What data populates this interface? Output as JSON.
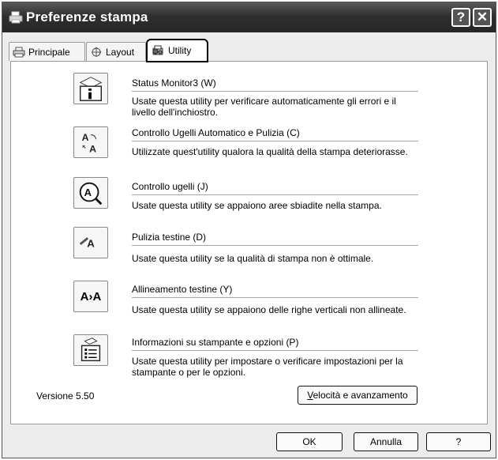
{
  "window": {
    "title": "Preferenze stampa",
    "help_glyph": "?",
    "close_glyph": "✕"
  },
  "tabs": [
    {
      "label": "Principale",
      "icon": "printer-icon"
    },
    {
      "label": "Layout",
      "icon": "layout-icon"
    },
    {
      "label": "Utility",
      "icon": "tools-icon",
      "selected": true
    }
  ],
  "utilities": [
    {
      "title": "Status Monitor3 (W)",
      "description": "Usate questa utility per verificare automaticamente gli errori e il livello dell'inchiostro.",
      "icon": "status-monitor-icon"
    },
    {
      "title": "Controllo Ugelli Automatico e Pulizia (C)",
      "description": "Utilizzate quest'utility qualora la qualità della stampa deteriorasse.",
      "icon": "auto-nozzle-check-icon"
    },
    {
      "title": "Controllo ugelli (J)",
      "description": "Usate questa utility se appaiono aree sbiadite nella stampa.",
      "icon": "nozzle-check-icon"
    },
    {
      "title": "Pulizia testine (D)",
      "description": "Usate questa utility se la qualità di stampa non è ottimale.",
      "icon": "head-cleaning-icon"
    },
    {
      "title": "Allineamento testine (Y)",
      "description": "Usate questa utility se appaiono delle righe verticali non allineate.",
      "icon": "head-alignment-icon",
      "icon_text": "A›A"
    },
    {
      "title": "Informazioni su stampante e opzioni (P)",
      "description": "Usate questa utility per impostare o verificare impostazioni per la stampante o per le opzioni.",
      "icon": "printer-info-icon"
    }
  ],
  "version_label": "Versione 5.50",
  "speed_button": {
    "accel": "V",
    "rest": "elocità e avanzamento"
  },
  "footer": {
    "ok": "OK",
    "cancel": "Annulla",
    "help": "?"
  }
}
